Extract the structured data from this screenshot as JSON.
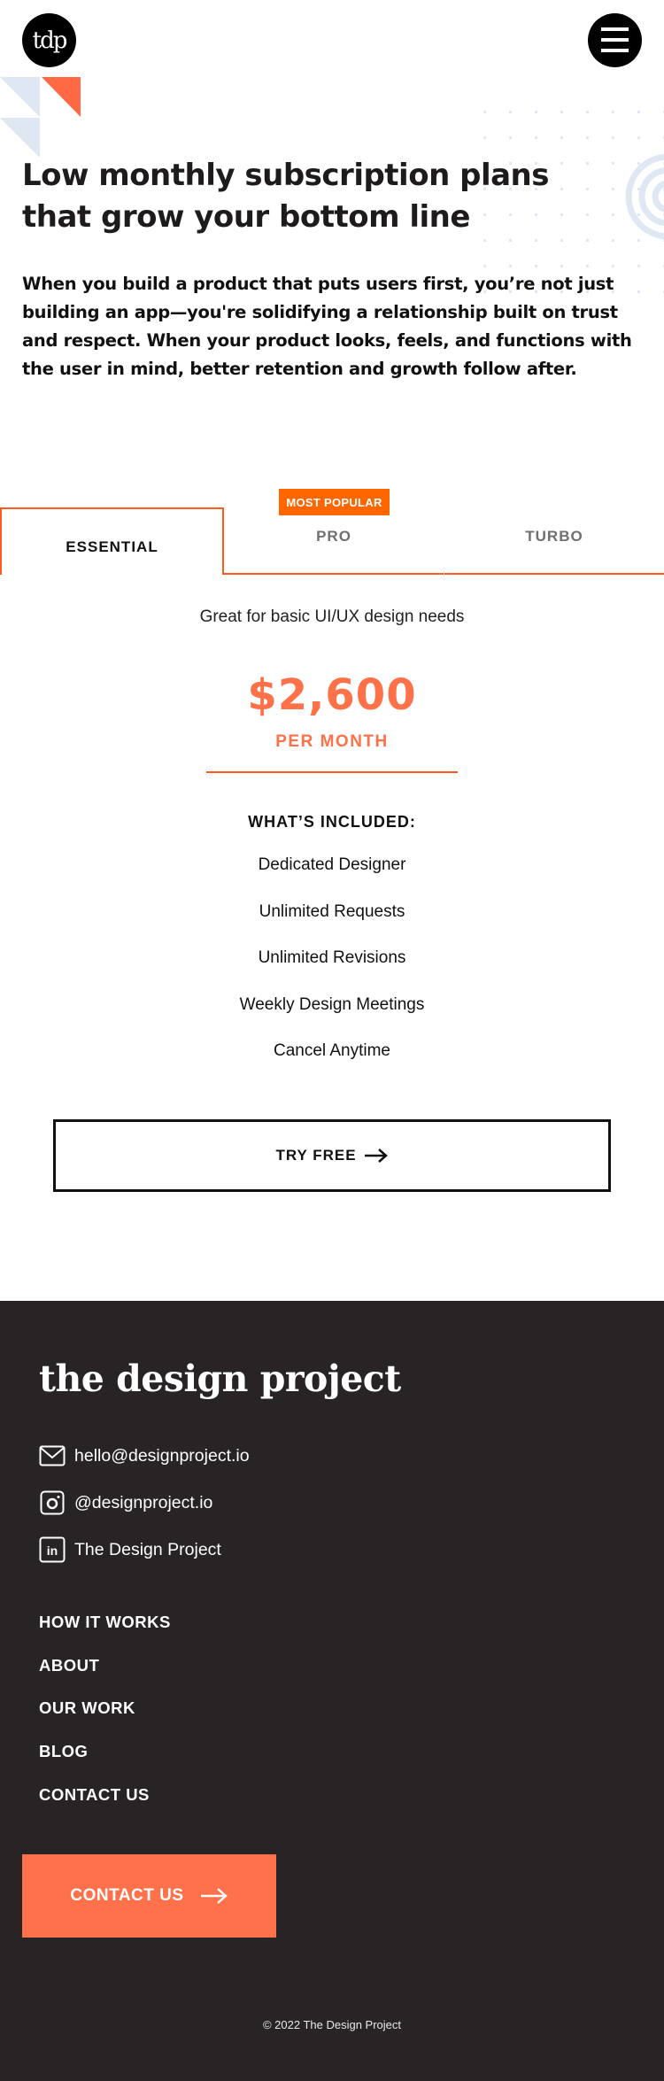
{
  "header": {
    "logo_text": "tdp",
    "menu_icon": "hamburger-menu-icon"
  },
  "hero": {
    "title": "Low monthly subscription plans that grow your bottom line",
    "text": "When you build a product that puts users first, you’re not just building an app—you're solidifying a relationship built on trust and respect. When your product looks, feels, and functions with the user in mind, better retention and growth follow after."
  },
  "plans": {
    "badge": "MOST POPULAR",
    "tabs": [
      {
        "label": "ESSENTIAL",
        "active": true
      },
      {
        "label": "PRO",
        "active": false
      },
      {
        "label": "TURBO",
        "active": false
      }
    ],
    "selected": {
      "description": "Great for basic UI/UX design needs",
      "price": "$2,600",
      "period": "PER MONTH",
      "included_title": "WHAT’S INCLUDED:",
      "features": [
        "Dedicated Designer",
        "Unlimited Requests",
        "Unlimited Revisions",
        "Weekly Design Meetings",
        "Cancel Anytime"
      ],
      "cta_label": "TRY FREE"
    }
  },
  "footer": {
    "brand": "the design project",
    "contacts": [
      {
        "icon": "mail-icon",
        "label": "hello@designproject.io"
      },
      {
        "icon": "instagram-icon",
        "label": "@designproject.io"
      },
      {
        "icon": "linkedin-icon",
        "label": "The Design Project"
      }
    ],
    "nav": [
      "HOW IT WORKS",
      "ABOUT",
      "OUR WORK",
      "BLOG",
      "CONTACT US"
    ],
    "cta_label": "CONTACT US",
    "copyright": "© 2022 The Design Project"
  },
  "colors": {
    "accent": "#ff714b",
    "tab_border": "#ff5a1f",
    "badge": "#ff6600",
    "footer_bg": "#282425",
    "decor_blue": "#dfe8f2"
  }
}
